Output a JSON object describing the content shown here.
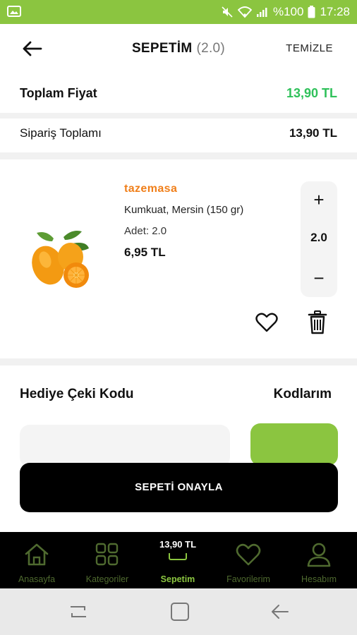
{
  "status_bar": {
    "battery": "%100",
    "time": "17:28"
  },
  "header": {
    "title": "SEPETİM",
    "count": "(2.0)",
    "clear_label": "TEMİZLE"
  },
  "totals": {
    "total_label": "Toplam Fiyat",
    "total_value": "13,90 TL",
    "order_label": "Sipariş Toplamı",
    "order_value": "13,90 TL"
  },
  "product": {
    "brand": "tazemasa",
    "name": "Kumkuat, Mersin (150 gr)",
    "quantity_label": "Adet:  2.0",
    "price": "6,95 TL",
    "stepper_value": "2.0",
    "plus_symbol": "+",
    "minus_symbol": "−"
  },
  "gift": {
    "label": "Hediye Çeki Kodu",
    "my_codes": "Kodlarım"
  },
  "confirm_button": "SEPETİ ONAYLA",
  "bottom_nav": {
    "items": [
      {
        "label": "Anasayfa",
        "icon": "home-icon"
      },
      {
        "label": "Kategoriler",
        "icon": "grid-icon"
      },
      {
        "label": "Sepetim",
        "icon": "basket-icon",
        "amount": "13,90 TL",
        "active": true
      },
      {
        "label": "Favorilerim",
        "icon": "heart-icon"
      },
      {
        "label": "Hesabım",
        "icon": "user-icon"
      }
    ]
  },
  "colors": {
    "accent": "#8bc540",
    "price_green": "#2fc15a",
    "brand_orange": "#f07f1a"
  }
}
